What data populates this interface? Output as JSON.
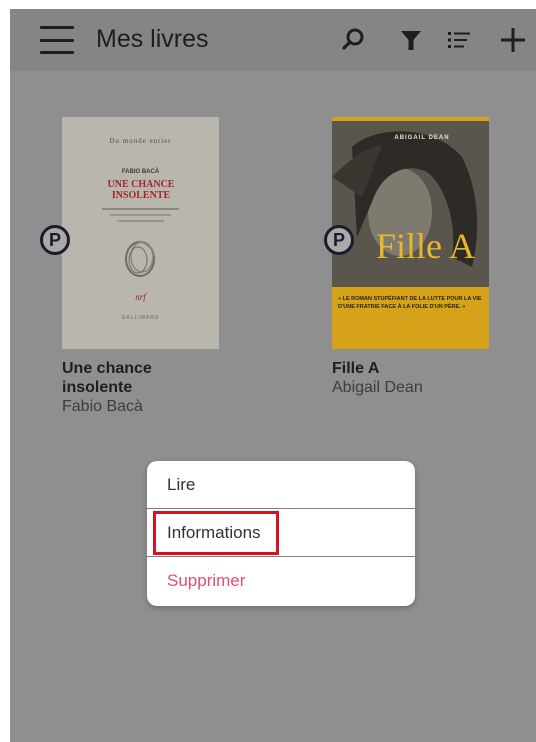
{
  "header": {
    "title": "Mes livres",
    "icons": [
      "menu-icon",
      "search-icon",
      "filter-icon",
      "list-view-icon",
      "add-icon"
    ]
  },
  "books": [
    {
      "title": "Une chance insolente",
      "author": "Fabio Bacà",
      "badge": "P",
      "cover": {
        "series": "Du monde entier",
        "author": "FABIO BACÀ",
        "title": "UNE CHANCE INSOLENTE",
        "publisher": "GALLIMARD"
      }
    },
    {
      "title": "Fille A",
      "author": "Abigail Dean",
      "badge": "P",
      "cover": {
        "author": "ABIGAIL DEAN",
        "title": "Fille A",
        "blurb": "« LE ROMAN STUPÉFIANT DE LA LUTTE POUR LA VIE D'UNE FRATRIE FACE À LA FOLIE D'UN PÈRE. »"
      }
    }
  ],
  "context_menu": {
    "items": [
      {
        "label": "Lire"
      },
      {
        "label": "Informations"
      },
      {
        "label": "Supprimer"
      }
    ]
  },
  "colors": {
    "overlay": "#8f8f8f",
    "header": "#858585",
    "danger": "#e24e72",
    "highlight": "#d8101e",
    "accent_yellow": "#d5a21a"
  }
}
